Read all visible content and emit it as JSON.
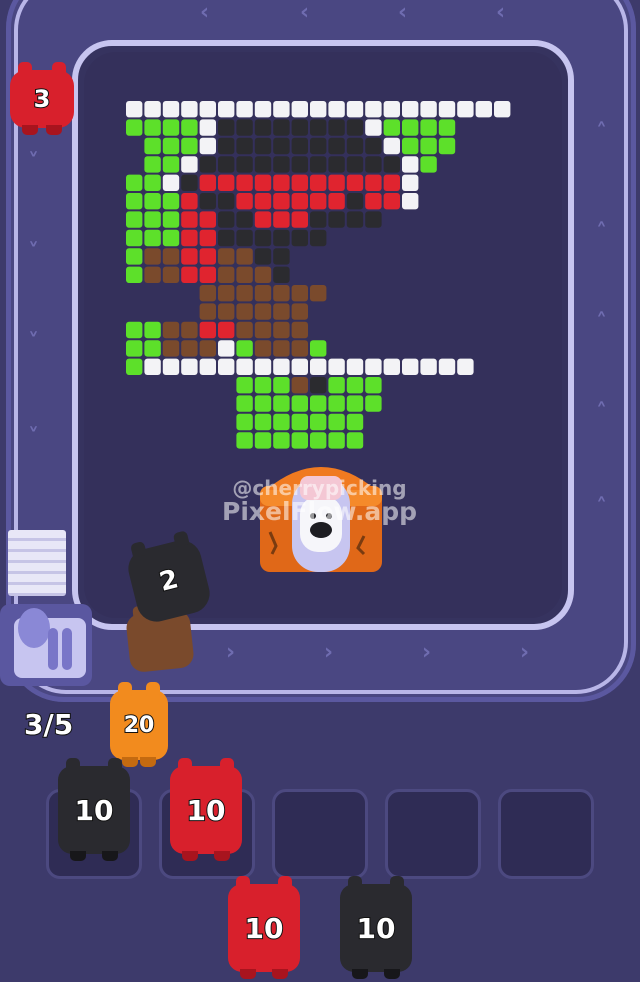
{
  "game": {
    "queue_counter": "3/5",
    "watermark": {
      "line1": "@cherrypicking",
      "line2": "PixelFlow.app"
    }
  },
  "belt_pig": {
    "value": "3",
    "color": "red"
  },
  "launcher_queue": [
    {
      "value": "2",
      "color": "black"
    },
    {
      "value": "",
      "color": "brown"
    }
  ],
  "next_pig": {
    "value": "20",
    "color": "orange"
  },
  "slots": [
    {
      "value": "10",
      "color": "black"
    },
    {
      "value": "10",
      "color": "red"
    },
    {
      "value": "",
      "color": ""
    },
    {
      "value": "",
      "color": ""
    },
    {
      "value": "",
      "color": ""
    }
  ],
  "bottom_pigs": [
    {
      "value": "10",
      "color": "red"
    },
    {
      "value": "10",
      "color": "black"
    }
  ],
  "colors": {
    "red": "#e0242f",
    "black": "#2b2b2f",
    "brown": "#7a4a2c",
    "orange": "#f28b1e",
    "green": "#5de02a",
    "white": "#f3f3f6",
    "background": "#3d3a6b",
    "track": "#c7c5f0"
  }
}
